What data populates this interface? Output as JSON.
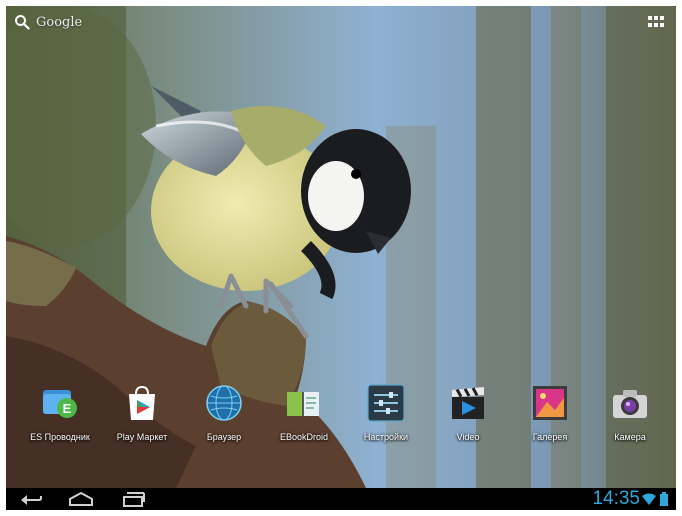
{
  "search": {
    "label": "Google"
  },
  "apps": [
    {
      "id": "es",
      "label": "ES Проводник",
      "icon": "es-file-explorer-icon"
    },
    {
      "id": "play",
      "label": "Play Маркет",
      "icon": "play-store-icon"
    },
    {
      "id": "browser",
      "label": "Браузер",
      "icon": "browser-globe-icon"
    },
    {
      "id": "ebook",
      "label": "EBookDroid",
      "icon": "ebook-icon"
    },
    {
      "id": "settings",
      "label": "Настройки",
      "icon": "settings-sliders-icon"
    },
    {
      "id": "video",
      "label": "Video",
      "icon": "video-clapper-icon"
    },
    {
      "id": "gallery",
      "label": "Галерея",
      "icon": "gallery-icon"
    },
    {
      "id": "camera",
      "label": "Камера",
      "icon": "camera-icon"
    }
  ],
  "status": {
    "time": "14:35"
  },
  "colors": {
    "clock": "#2ea8dc",
    "navbar": "#000000"
  }
}
